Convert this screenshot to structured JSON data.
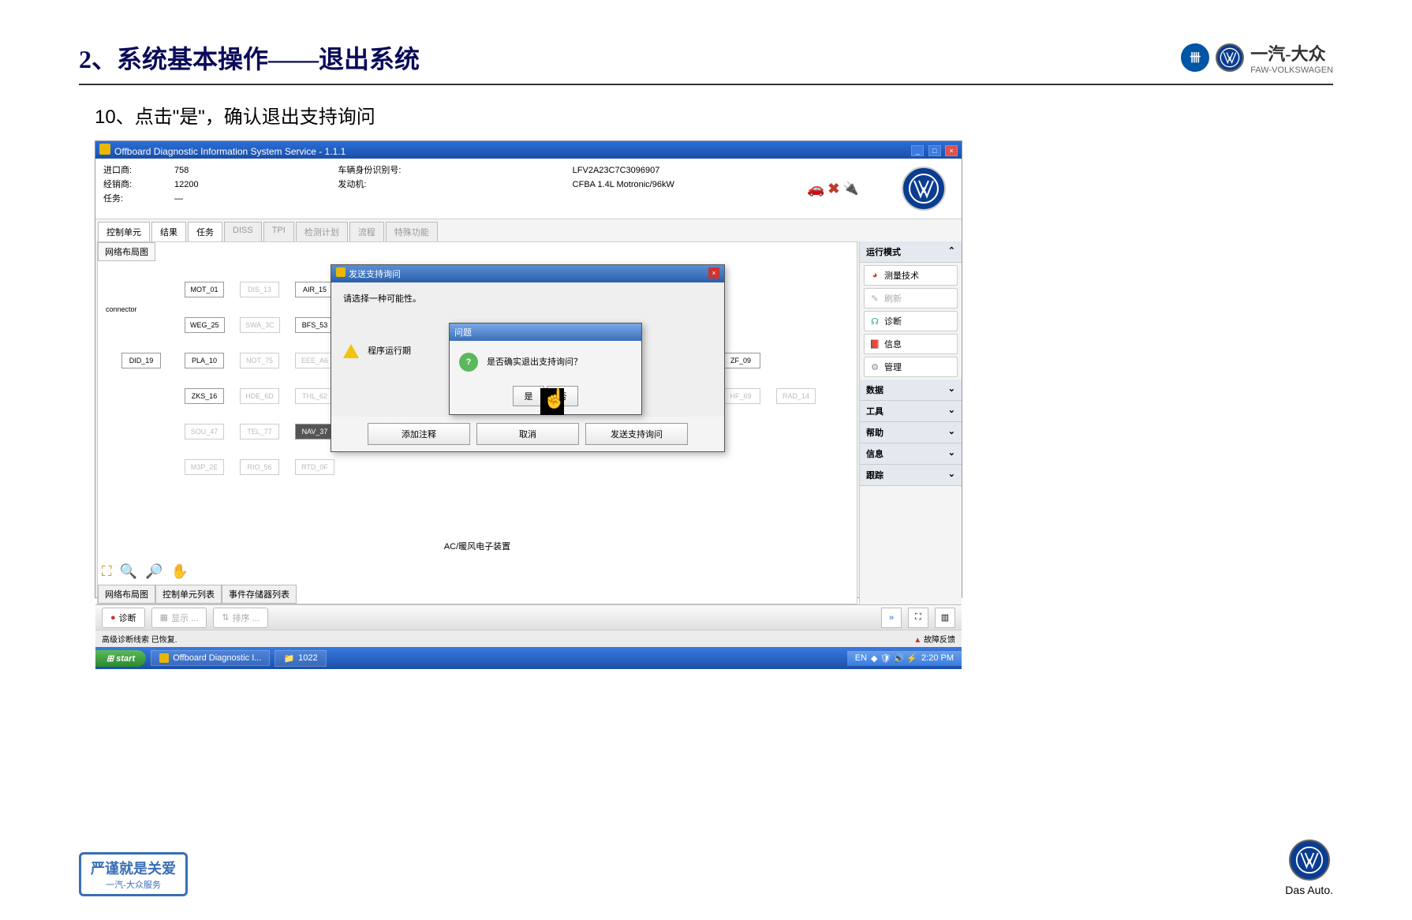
{
  "slide": {
    "title": "2、系统基本操作——退出系统",
    "subtitle": "10、点击\"是\"，确认退出支持询问",
    "brand_cn": "一汽-大众",
    "brand_en": "FAW-VOLKSWAGEN"
  },
  "app": {
    "window_title": "Offboard Diagnostic Information System Service - 1.1.1",
    "importer_label": "进口商:",
    "importer_value": "758",
    "dealer_label": "经销商:",
    "dealer_value": "12200",
    "task_label": "任务:",
    "task_value": "—",
    "vin_label": "车辆身份识别号:",
    "vin_value": "LFV2A23C7C3096907",
    "engine_label": "发动机:",
    "engine_value": "CFBA 1.4L Motronic/96kW",
    "tabs": [
      "控制单元",
      "结果",
      "任务",
      "DISS",
      "TPI",
      "检测计划",
      "流程",
      "特殊功能"
    ],
    "canvas_title": "网络布局图",
    "nodes": {
      "connector": "connector",
      "mot01": "MOT_01",
      "dis13": "DIS_13",
      "air15": "AIR_15",
      "weg25": "WEG_25",
      "swa3c": "SWA_3C",
      "bfs53": "BFS_53",
      "did19": "DID_19",
      "pla10": "PLA_10",
      "not75": "NOT_75",
      "eeea6": "EEE_A6",
      "zks16": "ZKS_16",
      "hde6d": "HDE_6D",
      "thl62": "THL_62",
      "sou47": "SOU_47",
      "tel77": "TEL_77",
      "nav37": "NAV_37",
      "m3p2e": "M3P_2E",
      "rio56": "RIO_56",
      "rtd0f": "RTD_0F",
      "zf09": "ZF_09",
      "hf69": "HF_69",
      "rad14": "RAD_14"
    },
    "bottom_label": "AC/暖风电子装置",
    "bottom_tabs": [
      "网络布局图",
      "控制单元列表",
      "事件存储器列表"
    ],
    "side_panel": {
      "mode_header": "运行模式",
      "measure": "测量技术",
      "refresh": "刷新",
      "diagnose": "诊断",
      "info": "信息",
      "manage": "管理",
      "data": "数据",
      "tools": "工具",
      "help": "帮助",
      "info2": "信息",
      "trace": "跟踪"
    },
    "outer_dialog": {
      "title": "发送支持询问",
      "prompt": "请选择一种可能性。",
      "running": "程序运行期",
      "btn_comment": "添加注释",
      "btn_cancel": "取消",
      "btn_send": "发送支持询问"
    },
    "inner_dialog": {
      "title": "问题",
      "message": "是否确实退出支持询问？",
      "yes": "是",
      "no": "否"
    },
    "status": {
      "diagnose": "诊断",
      "display": "显示 ...",
      "sort": "排序 ..."
    },
    "message_line": "高级诊断线索 已恢复.",
    "fault_feedback": "故障反馈",
    "taskbar": {
      "start": "start",
      "app": "Offboard Diagnostic I...",
      "folder": "1022",
      "lang": "EN",
      "time": "2:20 PM"
    }
  },
  "footer": {
    "slogan1": "严谨就是关爱",
    "slogan2": "一汽-大众服务",
    "das_auto": "Das Auto."
  }
}
